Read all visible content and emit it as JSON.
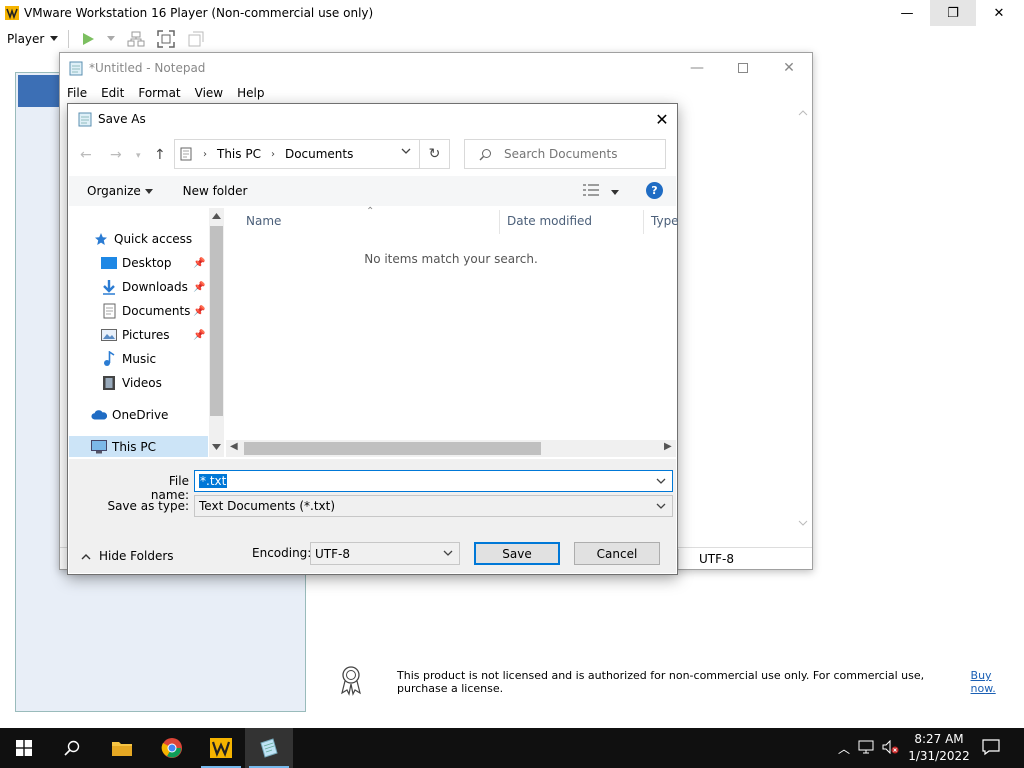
{
  "vmware": {
    "title": "VMware Workstation 16 Player (Non-commercial use only)",
    "min": "—",
    "max": "❐",
    "close": "✕",
    "player_menu": "Player",
    "license_text": "This product is not licensed and is authorized for non-commercial use only. For commercial use, purchase a license.",
    "license_link": "Buy now."
  },
  "notepad": {
    "title": "*Untitled - Notepad",
    "menu": [
      "File",
      "Edit",
      "Format",
      "View",
      "Help"
    ],
    "encoding_status": "UTF-8"
  },
  "save_as": {
    "title": "Save As",
    "breadcrumb": [
      "This PC",
      "Documents"
    ],
    "search_placeholder": "Search Documents",
    "organize": "Organize",
    "new_folder": "New folder",
    "nav_items": {
      "quick_access": "Quick access",
      "desktop": "Desktop",
      "downloads": "Downloads",
      "documents": "Documents",
      "pictures": "Pictures",
      "music": "Music",
      "videos": "Videos",
      "onedrive": "OneDrive",
      "this_pc": "This PC"
    },
    "columns": {
      "name": "Name",
      "date_modified": "Date modified",
      "type": "Type"
    },
    "empty_message": "No items match your search.",
    "file_name_label": "File name:",
    "file_name_value": "*.txt",
    "save_as_type_label": "Save as type:",
    "save_as_type_value": "Text Documents (*.txt)",
    "hide_folders": "Hide Folders",
    "encoding_label": "Encoding:",
    "encoding_value": "UTF-8",
    "save": "Save",
    "cancel": "Cancel"
  },
  "taskbar": {
    "time": "8:27 AM",
    "date": "1/31/2022"
  },
  "colors": {
    "accent": "#0078d7",
    "selection": "#cce4f7",
    "taskbar": "#101010"
  }
}
